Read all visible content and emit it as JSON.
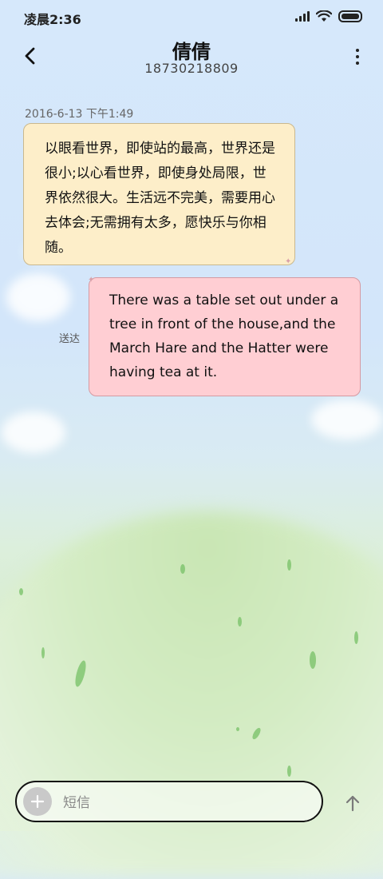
{
  "status_bar": {
    "time": "凌晨2:36",
    "icons": [
      "signal-icon",
      "wifi-icon",
      "battery-icon"
    ]
  },
  "header": {
    "contact_name": "倩倩",
    "contact_number": "18730218809",
    "back_icon": "chevron-left-icon",
    "more_icon": "more-vertical-icon"
  },
  "conversation": {
    "timestamp": "2016-6-13 下午1:49",
    "messages": [
      {
        "direction": "incoming",
        "text": "以眼看世界，即使站的最高，世界还是很小;以心看世界，即使身处局限，世界依然很大。生活远不完美，需要用心去体会;无需拥有太多，愿快乐与你相随。"
      },
      {
        "direction": "outgoing",
        "text": "There was a table set out under a tree in front of the house,and the March Hare and the Hatter were having tea at it.",
        "status": "送达"
      }
    ]
  },
  "compose": {
    "placeholder": "短信",
    "value": "",
    "add_icon": "plus-icon",
    "send_icon": "arrow-up-icon"
  },
  "colors": {
    "incoming_bubble": "#fdeec9",
    "outgoing_bubble": "#ffced3"
  }
}
